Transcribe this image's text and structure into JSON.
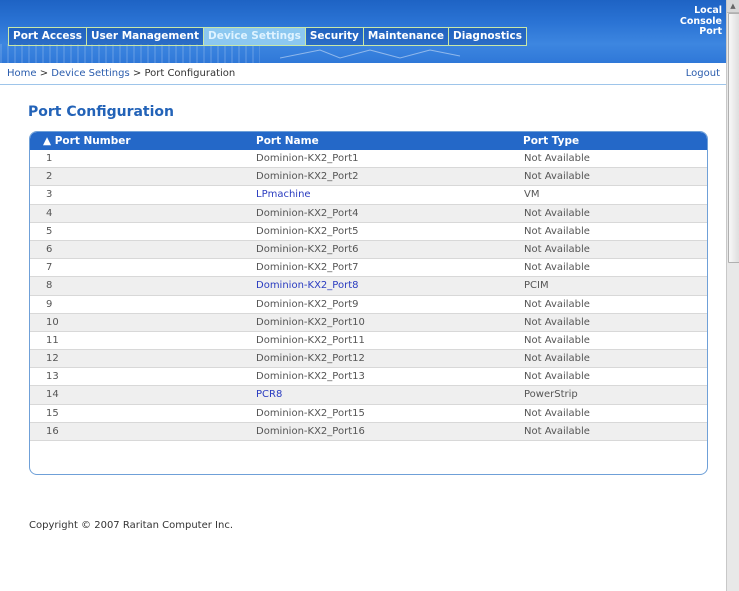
{
  "topnav": {
    "items": [
      {
        "label": "Port Access"
      },
      {
        "label": "User Management"
      },
      {
        "label": "Device Settings"
      },
      {
        "label": "Security"
      },
      {
        "label": "Maintenance"
      },
      {
        "label": "Diagnostics"
      }
    ],
    "active": "Device Settings"
  },
  "local_console": {
    "line1": "Local",
    "line2": "Console",
    "line3": "Port"
  },
  "breadcrumb": {
    "home": "Home",
    "sep": " > ",
    "section": "Device Settings",
    "current": "Port Configuration"
  },
  "logout_label": "Logout",
  "page_title": "Port Configuration",
  "table": {
    "headers": {
      "number": "▲ Port Number",
      "name": "Port Name",
      "type": "Port Type"
    },
    "rows": [
      {
        "number": "1",
        "name": "Dominion-KX2_Port1",
        "type": "Not Available",
        "link": false
      },
      {
        "number": "2",
        "name": "Dominion-KX2_Port2",
        "type": "Not Available",
        "link": false
      },
      {
        "number": "3",
        "name": "LPmachine",
        "type": "VM",
        "link": true
      },
      {
        "number": "4",
        "name": "Dominion-KX2_Port4",
        "type": "Not Available",
        "link": false
      },
      {
        "number": "5",
        "name": "Dominion-KX2_Port5",
        "type": "Not Available",
        "link": false
      },
      {
        "number": "6",
        "name": "Dominion-KX2_Port6",
        "type": "Not Available",
        "link": false
      },
      {
        "number": "7",
        "name": "Dominion-KX2_Port7",
        "type": "Not Available",
        "link": false
      },
      {
        "number": "8",
        "name": "Dominion-KX2_Port8",
        "type": "PCIM",
        "link": true
      },
      {
        "number": "9",
        "name": "Dominion-KX2_Port9",
        "type": "Not Available",
        "link": false
      },
      {
        "number": "10",
        "name": "Dominion-KX2_Port10",
        "type": "Not Available",
        "link": false
      },
      {
        "number": "11",
        "name": "Dominion-KX2_Port11",
        "type": "Not Available",
        "link": false
      },
      {
        "number": "12",
        "name": "Dominion-KX2_Port12",
        "type": "Not Available",
        "link": false
      },
      {
        "number": "13",
        "name": "Dominion-KX2_Port13",
        "type": "Not Available",
        "link": false
      },
      {
        "number": "14",
        "name": "PCR8",
        "type": "PowerStrip",
        "link": true
      },
      {
        "number": "15",
        "name": "Dominion-KX2_Port15",
        "type": "Not Available",
        "link": false
      },
      {
        "number": "16",
        "name": "Dominion-KX2_Port16",
        "type": "Not Available",
        "link": false
      }
    ]
  },
  "copyright": "Copyright © 2007 Raritan Computer Inc.",
  "colors": {
    "header_blue": "#2468c8",
    "link_blue": "#2a3cc0",
    "title_blue": "#2363b8",
    "active_tab": "#8cc8f0"
  }
}
